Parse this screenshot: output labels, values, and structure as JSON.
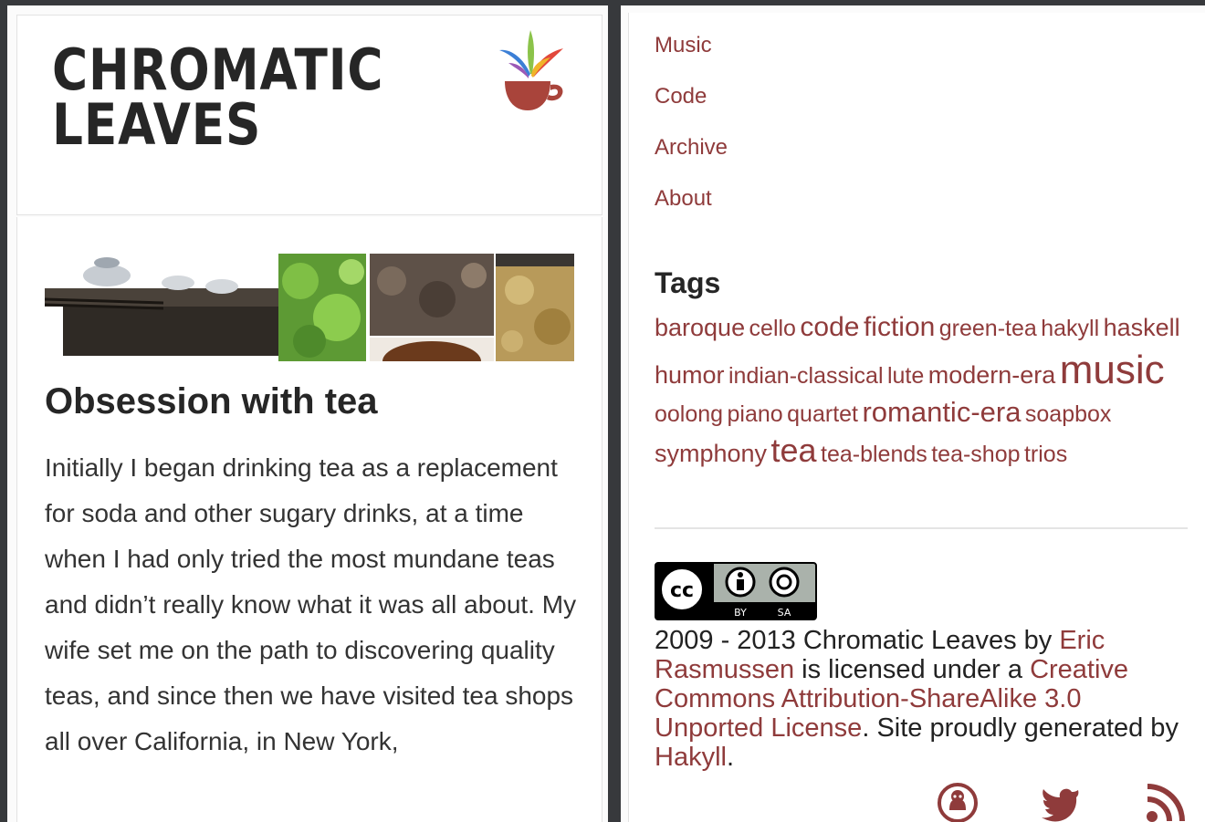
{
  "site": {
    "title_line1": "CHROMATIC",
    "title_line2": "LEAVES"
  },
  "post": {
    "title": "Obsession with tea",
    "body": "Initially I began drinking tea as a replacement for soda and other sugary drinks, at a time when I had only tried the most mundane teas and didn’t really know what it was all about. My wife set me on the path to discovering quality teas, and since then we have visited tea shops all over California, in New York,"
  },
  "nav": {
    "music": "Music",
    "code": "Code",
    "archive": "Archive",
    "about": "About"
  },
  "tags": {
    "title": "Tags",
    "items": [
      {
        "label": "baroque",
        "size": 27
      },
      {
        "label": "cello",
        "size": 25
      },
      {
        "label": "code",
        "size": 30
      },
      {
        "label": "fiction",
        "size": 30
      },
      {
        "label": "green-tea",
        "size": 25
      },
      {
        "label": "hakyll",
        "size": 25
      },
      {
        "label": "haskell",
        "size": 27
      },
      {
        "label": "humor",
        "size": 27
      },
      {
        "label": "indian-classical",
        "size": 25
      },
      {
        "label": "lute",
        "size": 25
      },
      {
        "label": "modern-era",
        "size": 27
      },
      {
        "label": "music",
        "size": 44
      },
      {
        "label": "oolong",
        "size": 25
      },
      {
        "label": "piano",
        "size": 25
      },
      {
        "label": "quartet",
        "size": 25
      },
      {
        "label": "romantic-era",
        "size": 31
      },
      {
        "label": "soapbox",
        "size": 25
      },
      {
        "label": "symphony",
        "size": 27
      },
      {
        "label": "tea",
        "size": 36
      },
      {
        "label": "tea-blends",
        "size": 25
      },
      {
        "label": "tea-shop",
        "size": 25
      },
      {
        "label": "trios",
        "size": 25
      }
    ]
  },
  "license": {
    "badge_cc": "cc",
    "badge_by": "BY",
    "badge_sa": "SA",
    "text1": "2009 - 2013 Chromatic Leaves by ",
    "author_link": "Eric Rasmussen",
    "text2": " is licensed under a ",
    "license_link": "Creative Commons Attribution-ShareAlike 3.0 Unported License",
    "text3": ". Site proudly generated by ",
    "hakyll_link": "Hakyll",
    "text4": "."
  },
  "social": [
    "github-icon",
    "twitter-icon",
    "rss-icon"
  ],
  "colors": {
    "accent": "#8f3b3b",
    "cup": "#a9443b",
    "background": "#37393c"
  }
}
